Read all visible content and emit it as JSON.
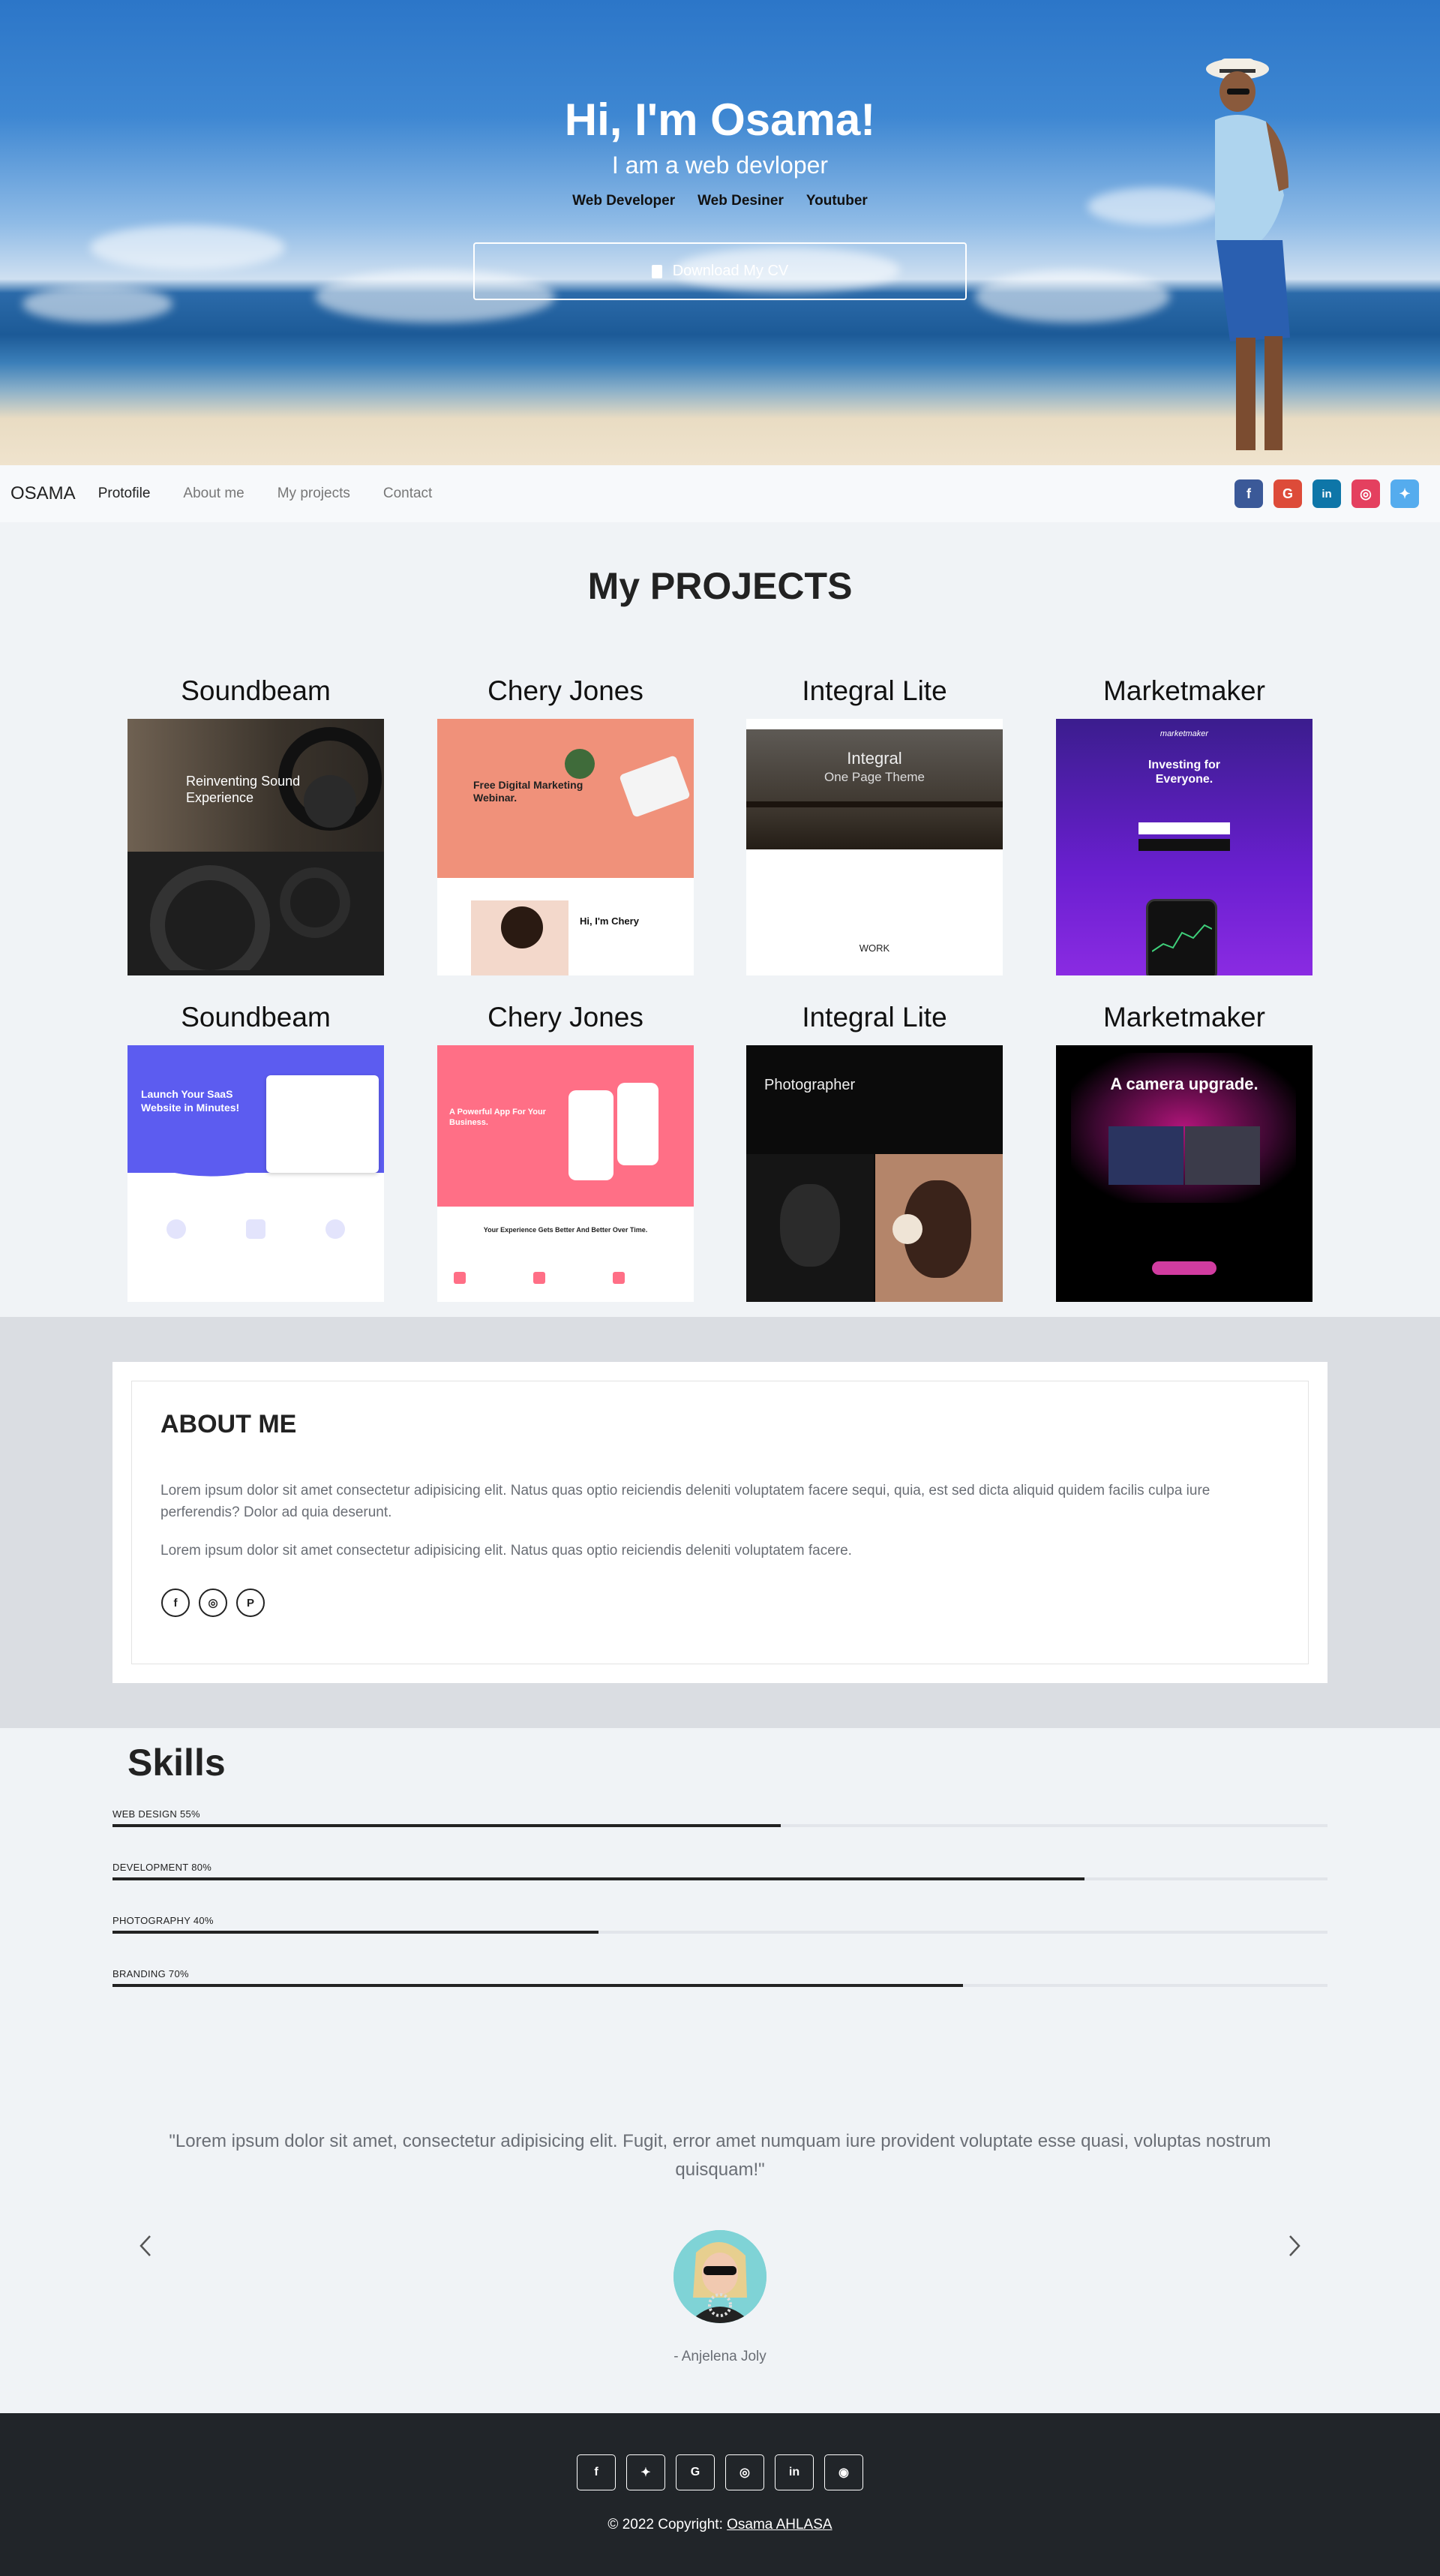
{
  "hero": {
    "title": "Hi, I'm Osama!",
    "subtitle": "I am a web devloper",
    "roles": [
      "Web Developer",
      "Web Desiner",
      "Youtuber"
    ],
    "cv_button": "Download My CV"
  },
  "nav": {
    "brand": "OSAMA",
    "links": [
      "Protofile",
      "About me",
      "My projects",
      "Contact"
    ],
    "social": [
      {
        "icon": "facebook-icon",
        "glyph": "f",
        "color": "#3b5998"
      },
      {
        "icon": "google-icon",
        "glyph": "G",
        "color": "#dd4b39"
      },
      {
        "icon": "linkedin-icon",
        "glyph": "in",
        "color": "#0e76a8"
      },
      {
        "icon": "instagram-icon",
        "glyph": "◎",
        "color": "#e4405f"
      },
      {
        "icon": "twitter-icon",
        "glyph": "✦",
        "color": "#55acee"
      }
    ]
  },
  "projects": {
    "title": "My PROJECTS",
    "row1": [
      "Soundbeam",
      "Chery Jones",
      "Integral Lite",
      "Marketmaker"
    ],
    "row2": [
      "Soundbeam",
      "Chery Jones",
      "Integral Lite",
      "Marketmaker"
    ],
    "thumbs": {
      "soundbeam1": "Reinventing Sound Experience",
      "chery1": "Free Digital Marketing Webinar.",
      "chery1b": "Hi, I'm Chery",
      "integral1": "Integral",
      "integral1b": "One Page Theme",
      "integral1c": "WORK",
      "market1": "Investing for Everyone.",
      "market1b": "marketmaker",
      "soundbeam2": "Launch Your SaaS Website in Minutes!",
      "chery2": "A Powerful App For Your Business.",
      "chery2b": "Your Experience Gets Better And Better Over Time.",
      "integral2": "Photographer",
      "market2": "A camera upgrade."
    }
  },
  "about": {
    "title": "ABOUT ME",
    "p1": "Lorem ipsum dolor sit amet consectetur adipisicing elit. Natus quas optio reiciendis deleniti voluptatem facere sequi, quia, est sed dicta aliquid quidem facilis culpa iure perferendis? Dolor ad quia deserunt.",
    "p2": "Lorem ipsum dolor sit amet consectetur adipisicing elit. Natus quas optio reiciendis deleniti voluptatem facere.",
    "icons": [
      "facebook-icon",
      "instagram-icon",
      "pinterest-icon"
    ]
  },
  "skills": {
    "title": "Skills",
    "items": [
      {
        "label": "WEB DESIGN 55%",
        "value": 0.55
      },
      {
        "label": "DEVELOPMENT 80%",
        "value": 0.8
      },
      {
        "label": "PHOTOGRAPHY 40%",
        "value": 0.4
      },
      {
        "label": "BRANDING 70%",
        "value": 0.7
      }
    ]
  },
  "testimonial": {
    "quote": "\"Lorem ipsum dolor sit amet, consectetur adipisicing elit. Fugit, error amet numquam iure provident voluptate esse quasi, voluptas nostrum quisquam!\"",
    "author": "- Anjelena Joly"
  },
  "footer": {
    "icons": [
      "facebook-icon",
      "twitter-icon",
      "google-icon",
      "instagram-icon",
      "linkedin-icon",
      "github-icon"
    ],
    "copyright": "© 2022 Copyright: ",
    "link": "Osama AHLASA"
  }
}
